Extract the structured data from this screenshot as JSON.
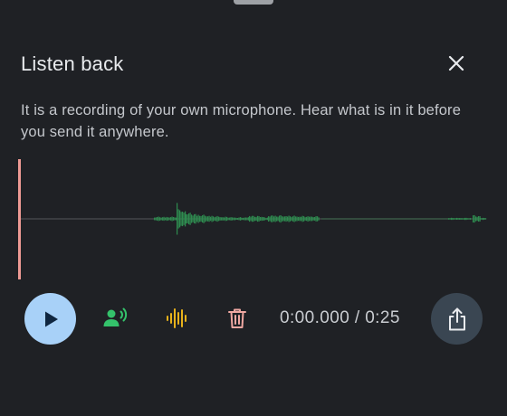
{
  "sheet": {
    "title": "Listen back",
    "description": "It is a recording of your own microphone. Hear what is in it before you send it anywhere."
  },
  "icons": {
    "close": "close-icon",
    "play": "play-icon",
    "voice": "voice-icon",
    "waveform": "waveform-icon",
    "delete": "trash-icon",
    "share": "share-icon"
  },
  "player": {
    "position": "0:00.000",
    "separator": " / ",
    "duration": "0:25",
    "playhead_fraction": 0
  },
  "colors": {
    "background": "#1f2125",
    "play_button": "#a8d1f8",
    "voice_icon": "#34c26b",
    "waveform_icon": "#e8b21b",
    "delete_icon": "#f0a8a2",
    "share_button": "#3a4652",
    "waveform": "#2e8b4f",
    "playhead": "#ee9a94"
  }
}
